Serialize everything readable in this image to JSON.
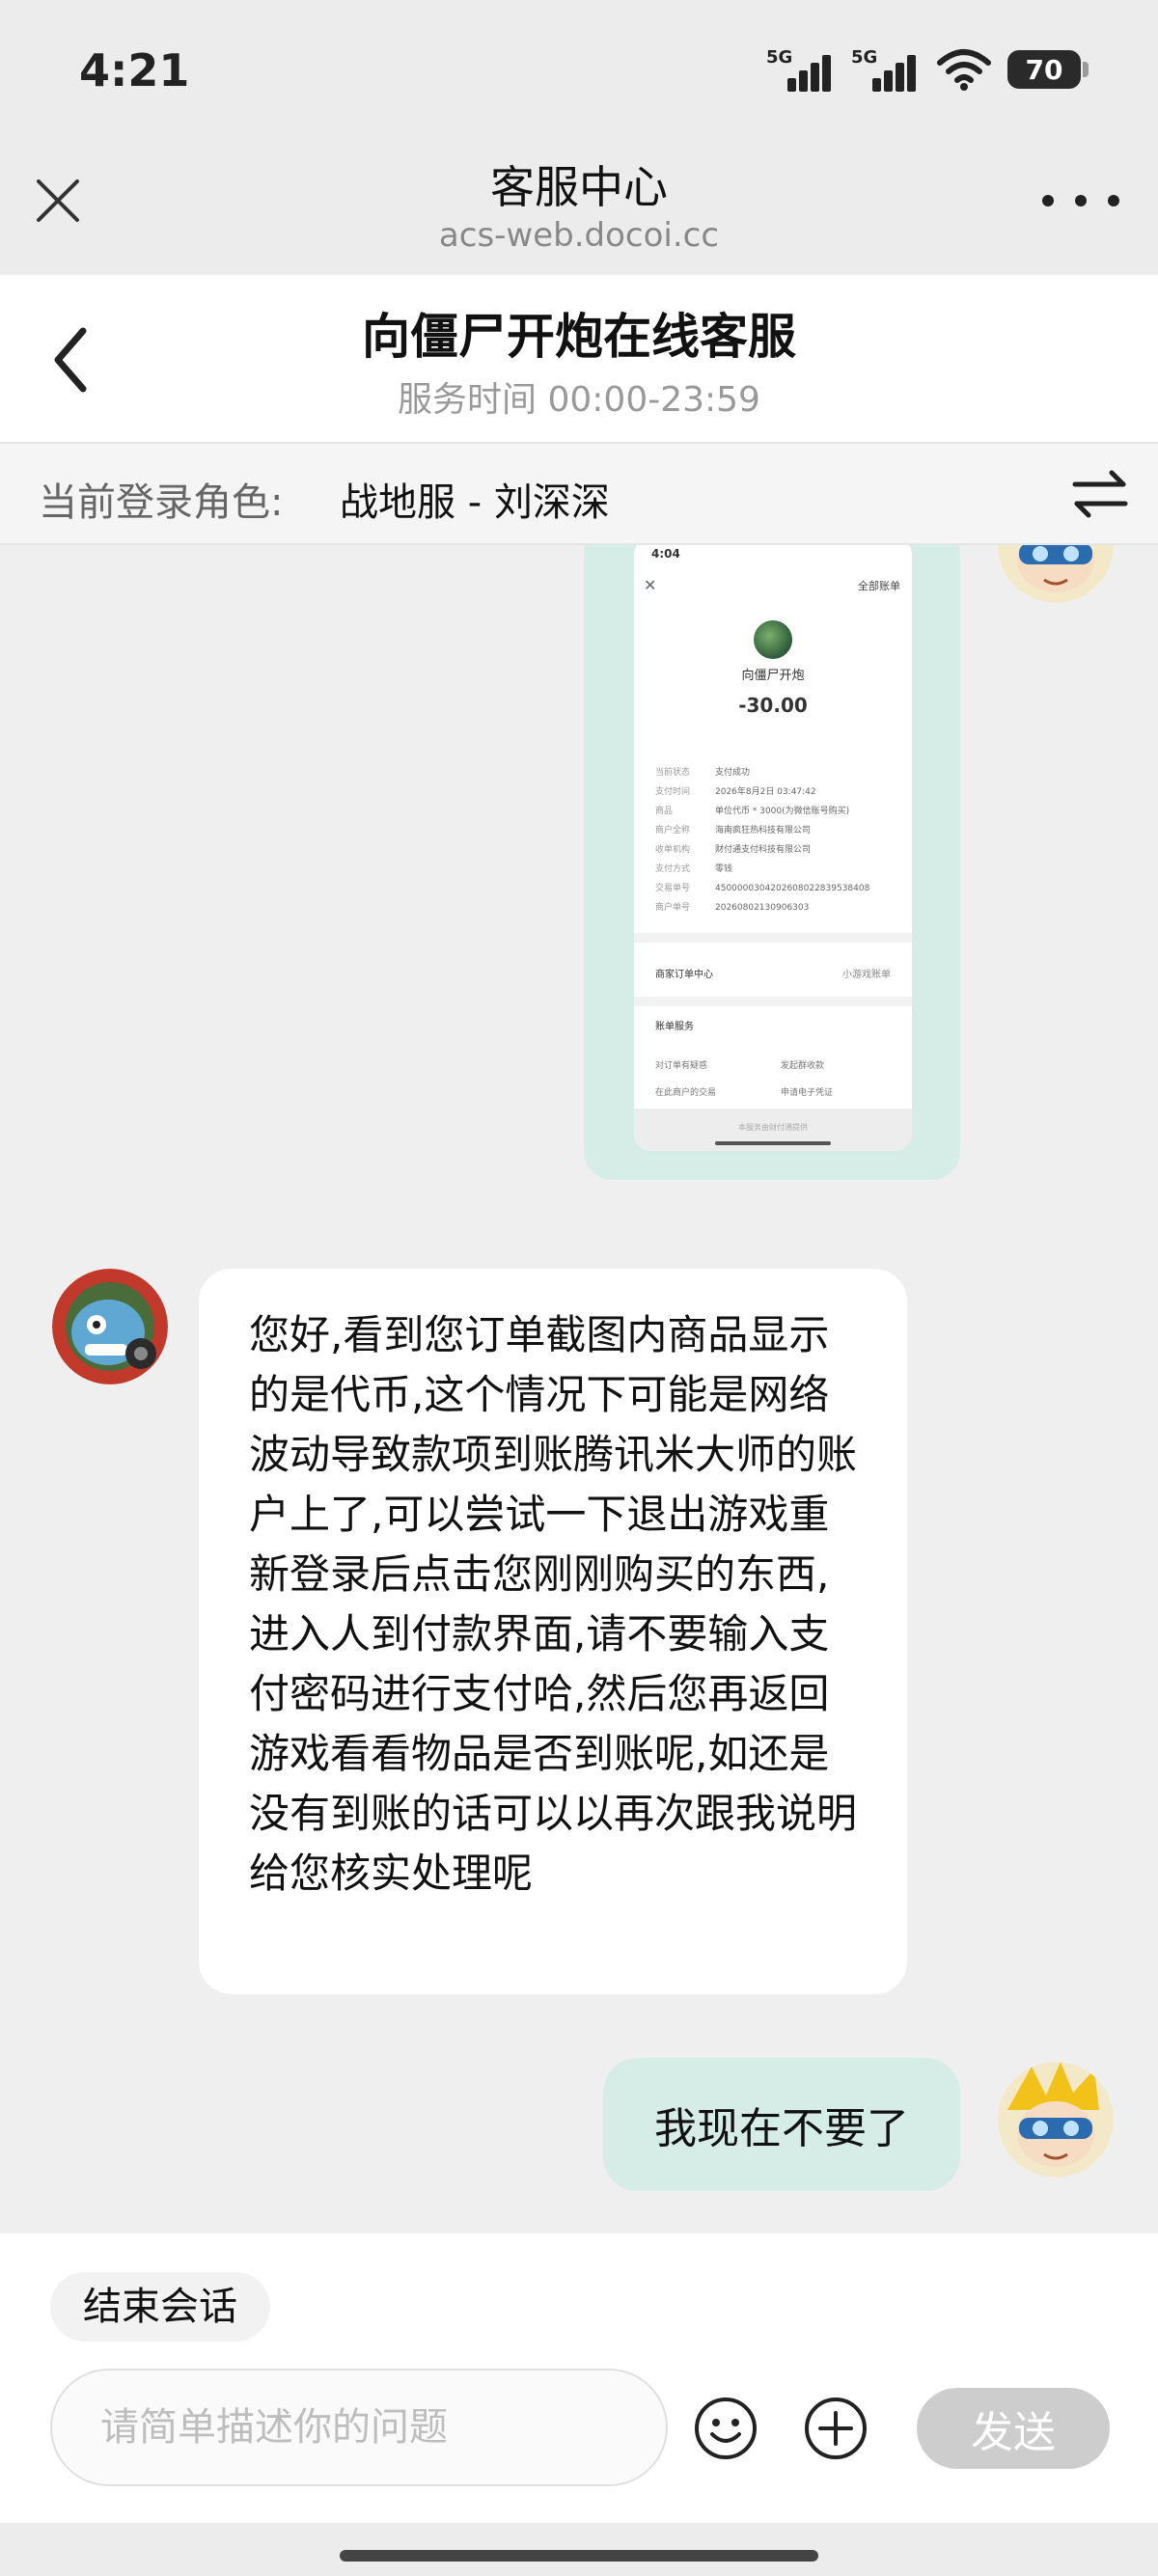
{
  "status_bar": {
    "time": "4:21",
    "signal1_label": "5G",
    "signal2_label": "5G",
    "battery": "70",
    "icons": [
      "signal-5g-icon",
      "signal-5g-icon",
      "wifi-icon",
      "battery-icon"
    ]
  },
  "web_header": {
    "title": "客服中心",
    "url": "acs-web.docoi.cc",
    "close_icon": "close-icon",
    "more_icon": "more-icon"
  },
  "service_header": {
    "title": "向僵尸开炮在线客服",
    "hours": "服务时间 00:00-23:59",
    "back_icon": "back-icon"
  },
  "role_bar": {
    "label": "当前登录角色:",
    "value": "战地服 - 刘深深",
    "switch_icon": "switch-icon"
  },
  "chat": {
    "screenshot": {
      "time": "4:04",
      "all_bills": "全部账单",
      "merchant": "向僵尸开炮",
      "amount": "-30.00",
      "rows": [
        {
          "k": "当前状态",
          "v": "支付成功"
        },
        {
          "k": "支付时间",
          "v": "2026年8月2日 03:47:42"
        },
        {
          "k": "商品",
          "v": "单位代币 * 3000(为微信账号购买)"
        },
        {
          "k": "商户全称",
          "v": "海南疯狂热科技有限公司"
        },
        {
          "k": "收单机构",
          "v": "财付通支付科技有限公司"
        },
        {
          "k": "支付方式",
          "v": "零钱"
        },
        {
          "k": "交易单号",
          "v": "4500000304202608022839538408"
        },
        {
          "k": "商户单号",
          "v": "20260802130906303"
        }
      ],
      "order_center": "商家订单中心",
      "mini_program": "小游戏账单",
      "account_service": "账单服务",
      "options": [
        "对订单有疑惑",
        "发起群收款",
        "在此商户的交易",
        "申请电子凭证"
      ],
      "footer": "本服务由财付通提供"
    },
    "agent_message": "您好,看到您订单截图内商品显示的是代币,这个情况下可能是网络波动导致款项到账腾讯米大师的账户上了,可以尝试一下退出游戏重新登录后点击您刚刚购买的东西,进入人到付款界面,请不要输入支付密码进行支付哈,然后您再返回游戏看看物品是否到账呢,如还是没有到账的话可以以再次跟我说明给您核实处理呢",
    "user_message": "我现在不要了"
  },
  "bottom_bar": {
    "end_session": "结束会话",
    "input_placeholder": "请简单描述你的问题",
    "send": "发送",
    "emoji_icon": "emoji-icon",
    "plus_icon": "plus-icon"
  },
  "colors": {
    "user_bubble": "#d6ece7",
    "send_disabled": "#cdcdcd",
    "header_bg": "#ececec"
  }
}
